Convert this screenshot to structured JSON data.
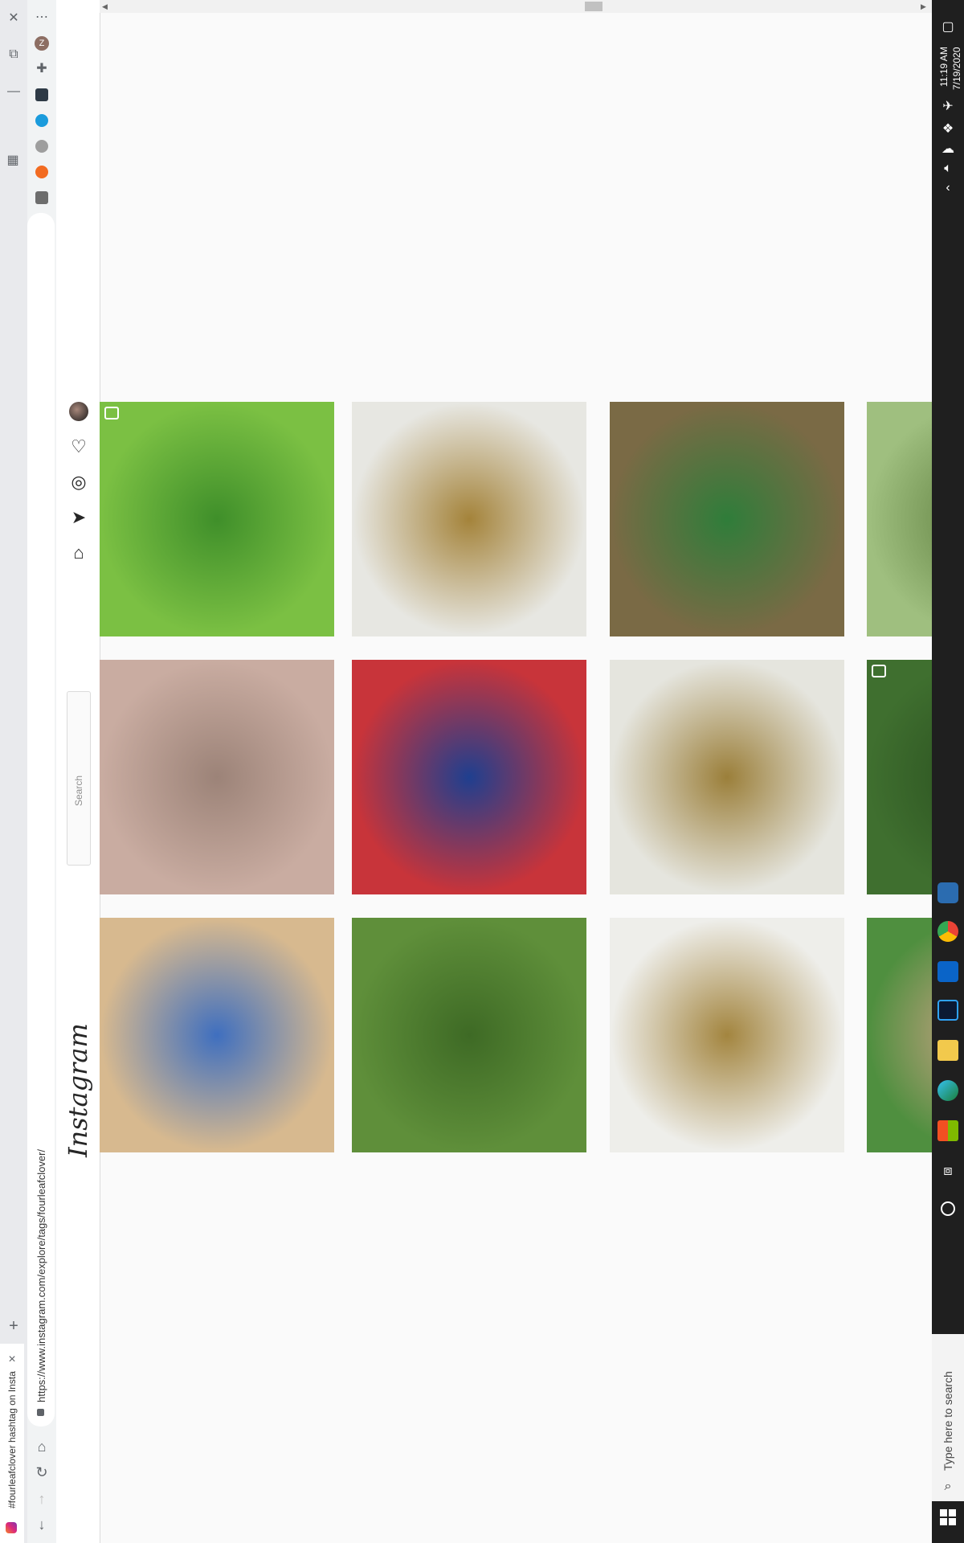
{
  "browser": {
    "tab_title": "#fourleafclover hashtag on Insta",
    "url": "https://www.instagram.com/explore/tags/fourleafclover/",
    "close_tab_glyph": "×",
    "new_tab_glyph": "+",
    "menu_glyph": "⋯",
    "profile_initial": "Z"
  },
  "instagram": {
    "logo": "Instagram",
    "search_placeholder": "Search",
    "nav_icons": [
      "home-icon",
      "direct-icon",
      "explore-icon",
      "activity-icon",
      "profile-avatar"
    ]
  },
  "taskbar": {
    "time": "11:19 AM",
    "date": "7/19/2020",
    "search_placeholder": "Type here to search"
  },
  "tiles": [
    {
      "name": "clover-patch",
      "colors": [
        "#7bc043",
        "#3f8f2a"
      ],
      "badge": "camera-icon"
    },
    {
      "name": "brass-compact-clovers",
      "colors": [
        "#e7e7e2",
        "#a4833a"
      ]
    },
    {
      "name": "hand-holding-clovers",
      "colors": [
        "#7a6a45",
        "#2f7d3a"
      ]
    },
    {
      "name": "grass-partial",
      "colors": [
        "#9fbf7f",
        "#5f7f3f"
      ]
    },
    {
      "name": "palm-clover-charm",
      "colors": [
        "#c9aca1",
        "#9c8378"
      ]
    },
    {
      "name": "clover-comic-bg",
      "colors": [
        "#c8343a",
        "#1f3f8f"
      ]
    },
    {
      "name": "open-brass-compact",
      "colors": [
        "#e5e5de",
        "#9b7f3a"
      ]
    },
    {
      "name": "green-partial",
      "colors": [
        "#3f6f2f",
        "#2a4f1f"
      ],
      "badge": "camera-icon"
    },
    {
      "name": "clovers-on-tin",
      "colors": [
        "#d7b98f",
        "#3f6fbf"
      ]
    },
    {
      "name": "hand-clover-lawn",
      "colors": [
        "#5f8f3a",
        "#3e6a25"
      ]
    },
    {
      "name": "brass-compact-lid",
      "colors": [
        "#eeeeea",
        "#a3853f"
      ]
    },
    {
      "name": "clover-hand-partial",
      "colors": [
        "#4f8f3f",
        "#d5a48a"
      ]
    }
  ]
}
